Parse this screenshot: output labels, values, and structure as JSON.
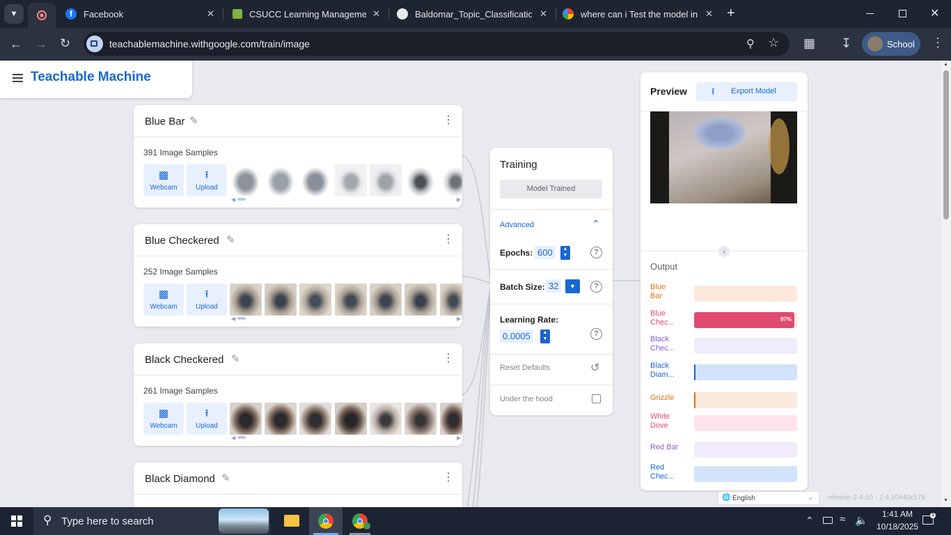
{
  "browser": {
    "tabs": [
      {
        "title": "Facebook"
      },
      {
        "title": "CSUCC Learning Management S"
      },
      {
        "title": "Baldomar_Topic_Classification_F"
      },
      {
        "title": "where can i Test the model in th"
      }
    ],
    "new_tab": "+",
    "url": "teachablemachine.withgoogle.com/train/image",
    "profile": "School"
  },
  "app": {
    "brand": "Teachable Machine"
  },
  "classes": [
    {
      "name": "Blue Bar",
      "samples": "391 Image Samples"
    },
    {
      "name": "Blue Checkered",
      "samples": "252 Image Samples"
    },
    {
      "name": "Black Checkered",
      "samples": "261 Image Samples"
    },
    {
      "name": "Black Diamond",
      "samples": ""
    }
  ],
  "class_buttons": {
    "webcam": "Webcam",
    "upload": "Upload"
  },
  "training": {
    "title": "Training",
    "status_button": "Model Trained",
    "advanced": "Advanced",
    "epochs_label": "Epochs:",
    "epochs": "600",
    "batch_label": "Batch Size:",
    "batch": "32",
    "lr_label": "Learning Rate:",
    "lr": "0.0005",
    "reset": "Reset Defaults",
    "under_hood": "Under the hood",
    "help": "?"
  },
  "preview": {
    "title": "Preview",
    "export": "Export Model",
    "output_title": "Output",
    "outputs": [
      {
        "label": "Blue\nBar",
        "value": 0,
        "color": "#e8710a",
        "track": "#fde8dc"
      },
      {
        "label": "Blue\nChec...",
        "value": 97,
        "percent_text": "97%",
        "color": "#e04b6f",
        "track": "#fce4ea"
      },
      {
        "label": "Black\nChec...",
        "value": 0,
        "color": "#8a5cd1",
        "track": "#f0ecfb"
      },
      {
        "label": "Black\nDiam...",
        "value": 1,
        "color": "#1967d2",
        "track": "#d2e3fb"
      },
      {
        "label": "Grizzle",
        "value": 1,
        "color": "#e8710a",
        "track": "#fde8dc"
      },
      {
        "label": "White\nDove",
        "value": 0,
        "color": "#e04b6f",
        "track": "#fce4ea"
      },
      {
        "label": "Red Bar",
        "value": 0,
        "color": "#8a5cd1",
        "track": "#f0ecfb"
      },
      {
        "label": "Red\nChec...",
        "value": 0,
        "color": "#1967d2",
        "track": "#d2e3fb"
      }
    ]
  },
  "footer": {
    "language": "English",
    "release": "release-2-4-10 - 2.4.10#40c178"
  },
  "taskbar": {
    "search": "Type here to search",
    "time": "1:41 AM",
    "date": "10/18/2025"
  }
}
